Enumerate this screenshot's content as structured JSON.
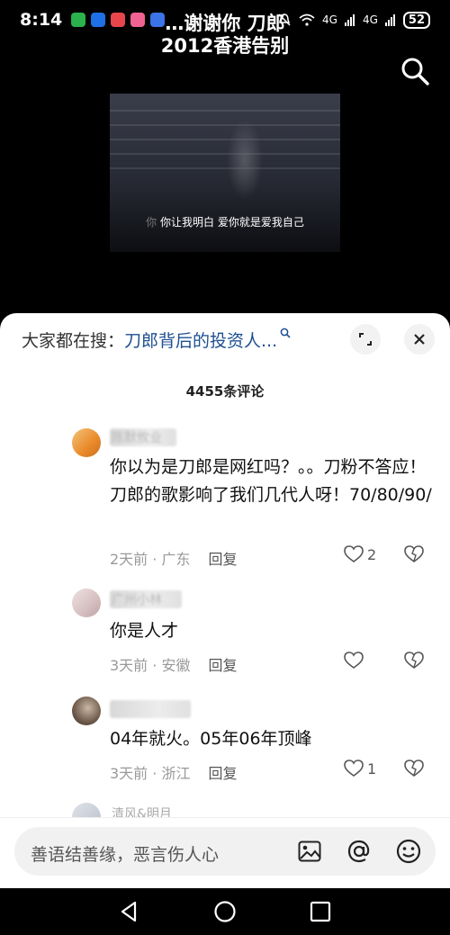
{
  "status_bar": {
    "time": "8:14",
    "network_1": "4G",
    "network_2": "4G",
    "battery": "52"
  },
  "video": {
    "title_line1": "…谢谢你 刀郎",
    "title_line2": "2012香港告别",
    "subtitle_prefix": "你",
    "subtitle": "你让我明白 爱你就是爱我自己"
  },
  "sheet": {
    "hot_search_label": "大家都在搜：",
    "hot_search_query": "刀郎背后的投资人...",
    "comment_count": "4455条评论"
  },
  "comments": [
    {
      "username": "陈默攸业",
      "text": "你以为是刀郎是网红吗？。。刀粉不答应！刀郎的歌影响了我们几代人呀！70/80/90/",
      "time": "2天前",
      "location": "广东",
      "reply_label": "回复",
      "likes": "2"
    },
    {
      "username": "广州小林",
      "text": "你是人才",
      "time": "3天前",
      "location": "安徽",
      "reply_label": "回复",
      "likes": ""
    },
    {
      "username": "",
      "text": "04年就火。05年06年顶峰",
      "time": "3天前",
      "location": "浙江",
      "reply_label": "回复",
      "likes": "1"
    },
    {
      "username": "清风&明月"
    }
  ],
  "input": {
    "placeholder": "善语结善缘，恶言伤人心"
  },
  "colors": {
    "link_blue": "#1d4f91",
    "meta_gray": "#999999"
  }
}
